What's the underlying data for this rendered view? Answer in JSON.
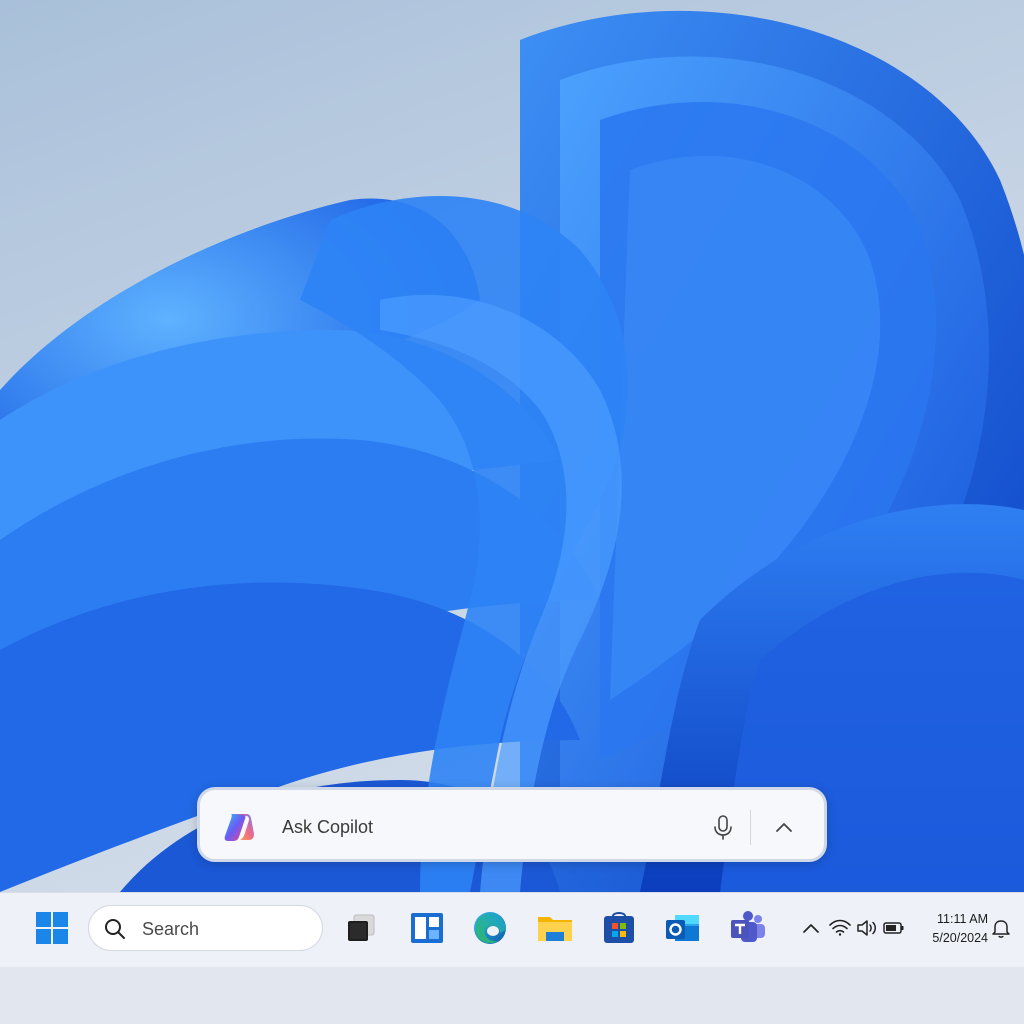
{
  "copilot": {
    "prompt_placeholder": "Ask Copilot",
    "mic_icon": "microphone-icon",
    "expand_icon": "chevron-up-icon",
    "logo_icon": "copilot-logo-icon"
  },
  "taskbar": {
    "start_icon": "windows-start-icon",
    "search": {
      "placeholder": "Search",
      "icon": "search-icon"
    },
    "pinned_apps": [
      {
        "name": "Task View",
        "icon": "task-view-icon"
      },
      {
        "name": "Widgets",
        "icon": "widgets-icon"
      },
      {
        "name": "Microsoft Edge",
        "icon": "edge-icon"
      },
      {
        "name": "File Explorer",
        "icon": "folder-icon"
      },
      {
        "name": "Microsoft Store",
        "icon": "store-icon"
      },
      {
        "name": "Outlook",
        "icon": "outlook-icon"
      },
      {
        "name": "Microsoft Teams",
        "icon": "teams-icon"
      }
    ],
    "tray": {
      "overflow_icon": "chevron-up-icon",
      "wifi_icon": "wifi-icon",
      "volume_icon": "volume-icon",
      "battery_icon": "battery-icon",
      "time": "11:11 AM",
      "date": "5/20/2024",
      "notification_icon": "bell-icon"
    }
  },
  "colors": {
    "accent": "#0067c0",
    "wallpaper_blue": "#1a66e8",
    "taskbar_bg": "#eef1f7"
  }
}
